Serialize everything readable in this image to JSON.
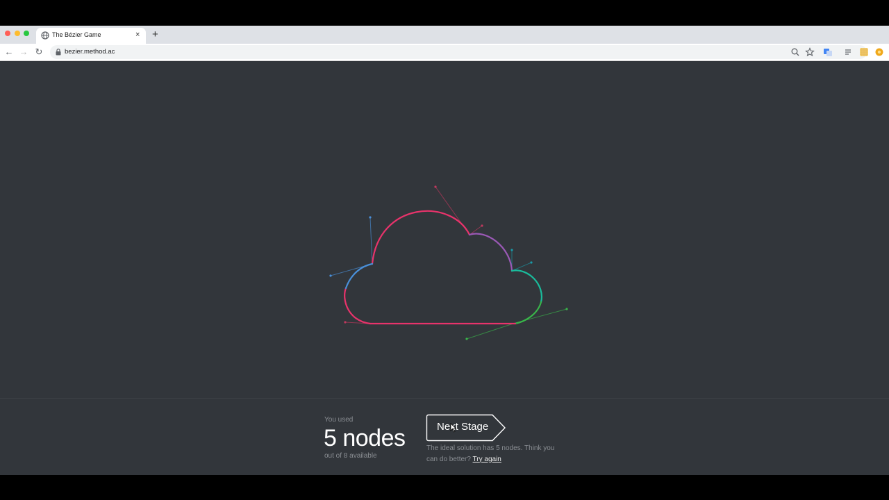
{
  "browser": {
    "tab_title": "The Bézier Game",
    "tab_close": "×",
    "new_tab": "+",
    "url": "bezier.method.ac",
    "nav_back": "←",
    "nav_forward": "→",
    "nav_reload": "↻"
  },
  "result": {
    "used_label": "You used",
    "nodes": "5 nodes",
    "available": "out of 8 available",
    "next_button": "Next Stage",
    "hint": "The ideal solution has 5 nodes. Think you can do better?",
    "try_again": "Try again"
  },
  "canvas": {
    "shape": "cloud",
    "background": "#32363b",
    "segment_colors": [
      "#e8336b",
      "#4a90d9",
      "#9b59b6",
      "#1abc9c",
      "#39b54a"
    ]
  }
}
